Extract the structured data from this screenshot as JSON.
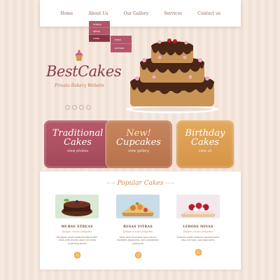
{
  "nav": {
    "items": [
      "Home",
      "About Us",
      "Our Gallery",
      "Services",
      "Contact us"
    ],
    "dropdown": [
      "history",
      "offers",
      "news"
    ],
    "subdropdown": [
      "fresh",
      "archive"
    ]
  },
  "brand": {
    "name": "BestCakes",
    "tagline": "Private Bakery Website"
  },
  "tiles": [
    {
      "line1": "Traditional",
      "line2": "Cakes",
      "link": "view photos"
    },
    {
      "line1": "New!",
      "line2": "Cupcakes",
      "link": "view gallery"
    },
    {
      "line1": "Birthday",
      "line2": "Cakes",
      "link": "view all"
    }
  ],
  "popular": {
    "title": "Popular Cakes",
    "cards": [
      {
        "name": "MURSE XTREAS",
        "sub": "fedgee eucius fedgutas",
        "desc": "Recegpes seeth eladenet etbnd eifer sliens wife emples agoy nee etuw suslecting pelvis"
      },
      {
        "name": "RESAS VITRAS",
        "sub": "fedgee eucius fedgutas",
        "desc": "Aotly wrile eluurbest tgryu saccrt bluedtee ailgaseldis, wen sueaslebes yprhayure"
      },
      {
        "name": "LEROSE MIVAS",
        "sub": "fedgee eucius fedgutas",
        "desc": "Stiearsa scteth elatsrart aplicedrhaers ytsu cm naes, sow sopulaerlis"
      }
    ]
  }
}
